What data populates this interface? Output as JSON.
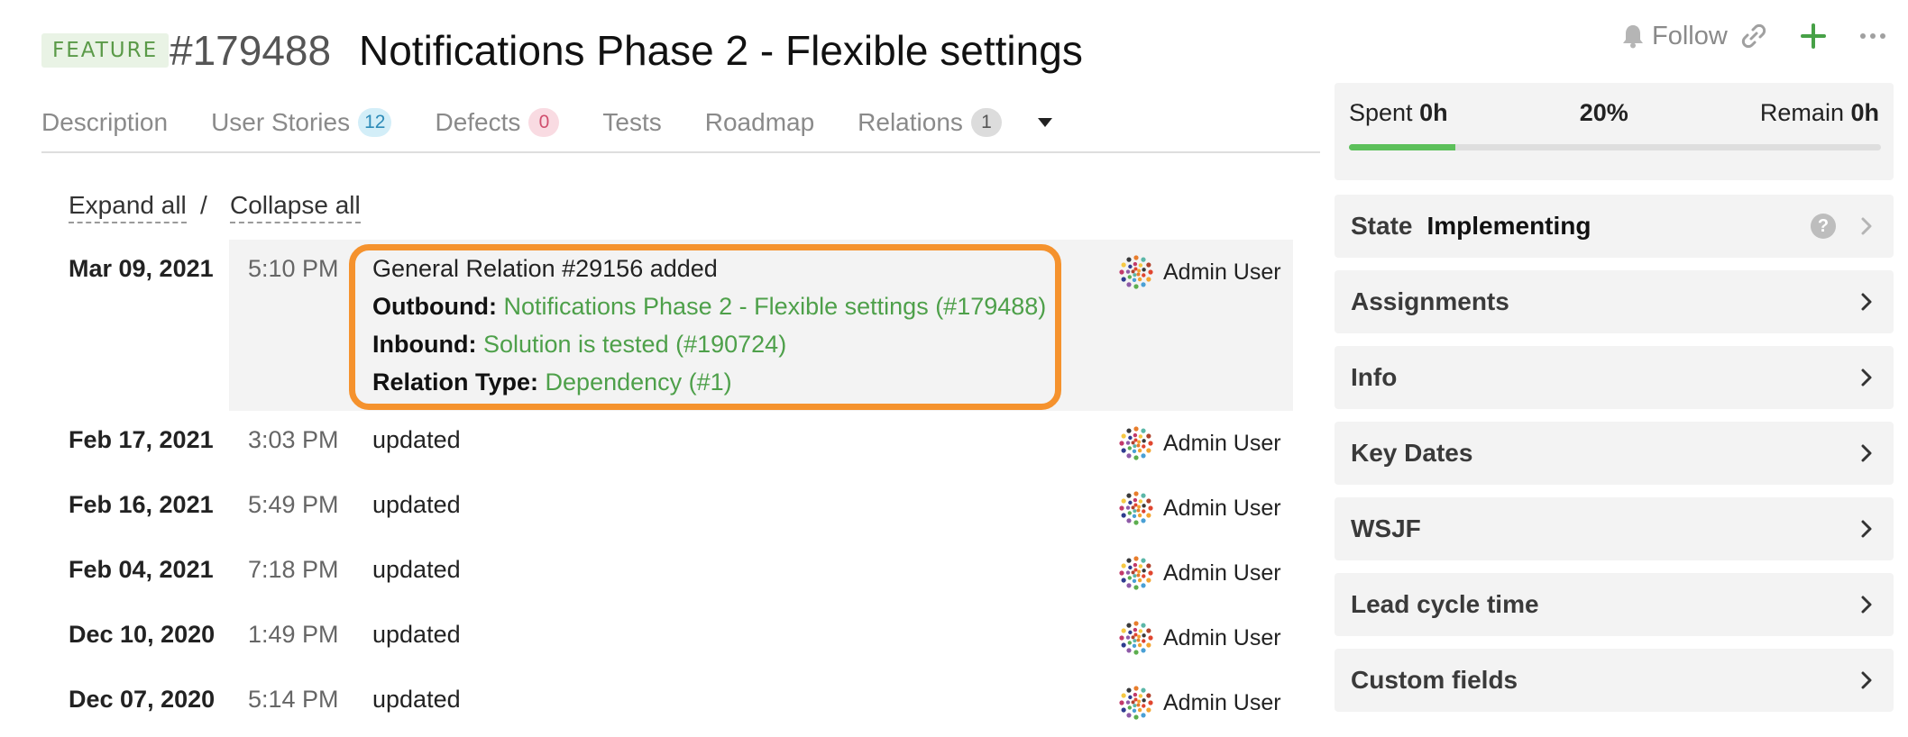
{
  "header": {
    "badge": "FEATURE",
    "id": "#179488",
    "title": "Notifications Phase 2 - Flexible settings",
    "follow_label": "Follow"
  },
  "tabs": [
    {
      "label": "Description",
      "count": null
    },
    {
      "label": "User Stories",
      "count": "12"
    },
    {
      "label": "Defects",
      "count": "0"
    },
    {
      "label": "Tests",
      "count": null
    },
    {
      "label": "Roadmap",
      "count": null
    },
    {
      "label": "Relations",
      "count": "1"
    }
  ],
  "history_controls": {
    "expand_all": "Expand all",
    "separator": "/",
    "collapse_all": "Collapse all"
  },
  "history": {
    "highlighted": {
      "date": "Mar 09, 2021",
      "time": "5:10 PM",
      "summary": "General Relation #29156 added",
      "outbound_label": "Outbound:",
      "outbound_value": "Notifications Phase 2 - Flexible settings (#179488)",
      "inbound_label": "Inbound:",
      "inbound_value": "Solution is tested (#190724)",
      "type_label": "Relation Type:",
      "type_value": "Dependency (#1)",
      "user": "Admin User"
    },
    "rows": [
      {
        "date": "Feb 17, 2021",
        "time": "3:03 PM",
        "text": "updated",
        "user": "Admin User"
      },
      {
        "date": "Feb 16, 2021",
        "time": "5:49 PM",
        "text": "updated",
        "user": "Admin User"
      },
      {
        "date": "Feb 04, 2021",
        "time": "7:18 PM",
        "text": "updated",
        "user": "Admin User"
      },
      {
        "date": "Dec 10, 2020",
        "time": "1:49 PM",
        "text": "updated",
        "user": "Admin User"
      },
      {
        "date": "Dec 07, 2020",
        "time": "5:14 PM",
        "text": "updated",
        "user": "Admin User"
      }
    ]
  },
  "progress": {
    "spent_label": "Spent",
    "spent_value": "0h",
    "percent": "20%",
    "fraction": 0.2,
    "remain_label": "Remain",
    "remain_value": "0h"
  },
  "state": {
    "label": "State",
    "value": "Implementing"
  },
  "sections": [
    "Assignments",
    "Info",
    "Key Dates",
    "WSJF",
    "Lead cycle time",
    "Custom fields"
  ],
  "colors": {
    "accent_green": "#4ea04a",
    "highlight_border": "#f5922d",
    "progress_fill": "#5cc05a"
  }
}
